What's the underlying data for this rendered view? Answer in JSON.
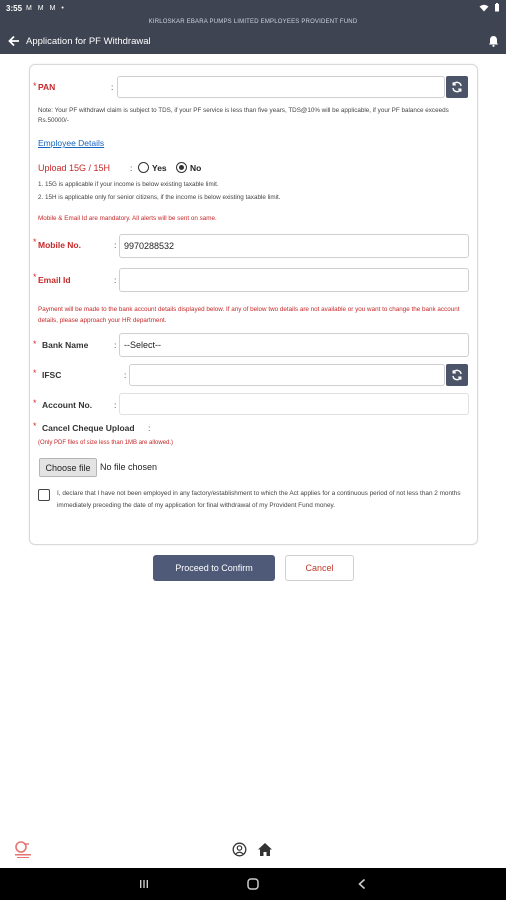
{
  "status_bar": {
    "time": "3:55",
    "notification_icons": "M M M •",
    "system_icons": "wifi-icon battery-icon"
  },
  "header": {
    "org_name": "KIRLOSKAR EBARA PUMPS LIMITED EMPLOYEES PROVIDENT FUND",
    "title": "Application for PF Withdrawal"
  },
  "form": {
    "pan": {
      "required_mark": "*",
      "label": "PAN",
      "value": ""
    },
    "note": "Note: Your PF withdrawl claim is subject to TDS, if your PF service is less than five years, TDS@10% will be applicable, if your PF balance exceeds Rs.50000/-",
    "employee_details_link": "Employee Details",
    "upload_15g": {
      "label": "Upload 15G / 15H",
      "options": [
        "Yes",
        "No"
      ],
      "selected": "No",
      "hints": [
        "1. 15G is applicable if your income is below existing taxable limit.",
        "2. 15H is applicable only for senior citizens, if the income is below existing taxable limit."
      ]
    },
    "mandatory_note": "Mobile & Email Id are mandatory. All alerts will be sent on same.",
    "mobile": {
      "required_mark": "*",
      "label": "Mobile No.",
      "value": "9970288532"
    },
    "email": {
      "required_mark": "*",
      "label": "Email Id",
      "value": ""
    },
    "payment_note": "Payment will be made to the bank account details displayed below. If any of below two details are not available or you want to change the bank account details, please approach your HR department.",
    "bank_name": {
      "required_mark": "*",
      "label": "Bank Name",
      "selected": "--Select--"
    },
    "ifsc": {
      "required_mark": "*",
      "label": "IFSC",
      "value": ""
    },
    "account_no": {
      "required_mark": "*",
      "label": "Account No.",
      "value": ""
    },
    "cheque_upload": {
      "required_mark": "*",
      "label": "Cancel Cheque Upload",
      "hint": "(Only PDF files of size less than 1MB are allowed.)",
      "choose_button": "Choose file",
      "file_status": "No file chosen"
    },
    "declaration": "I, declare that I have not been employed in any factory/establishment to which the Act applies for a continuous period of not less than 2 months immediately preceding the date of my application for final withdrawal of my Provident Fund money."
  },
  "actions": {
    "proceed": "Proceed to Confirm",
    "cancel": "Cancel"
  },
  "colors": {
    "header_bg": "#3f4452",
    "primary_button": "#4e5a78",
    "required_red": "#c62828",
    "link_blue": "#1565c0"
  },
  "bottom_icons": [
    "logo-icon",
    "profile-icon",
    "home-icon"
  ]
}
